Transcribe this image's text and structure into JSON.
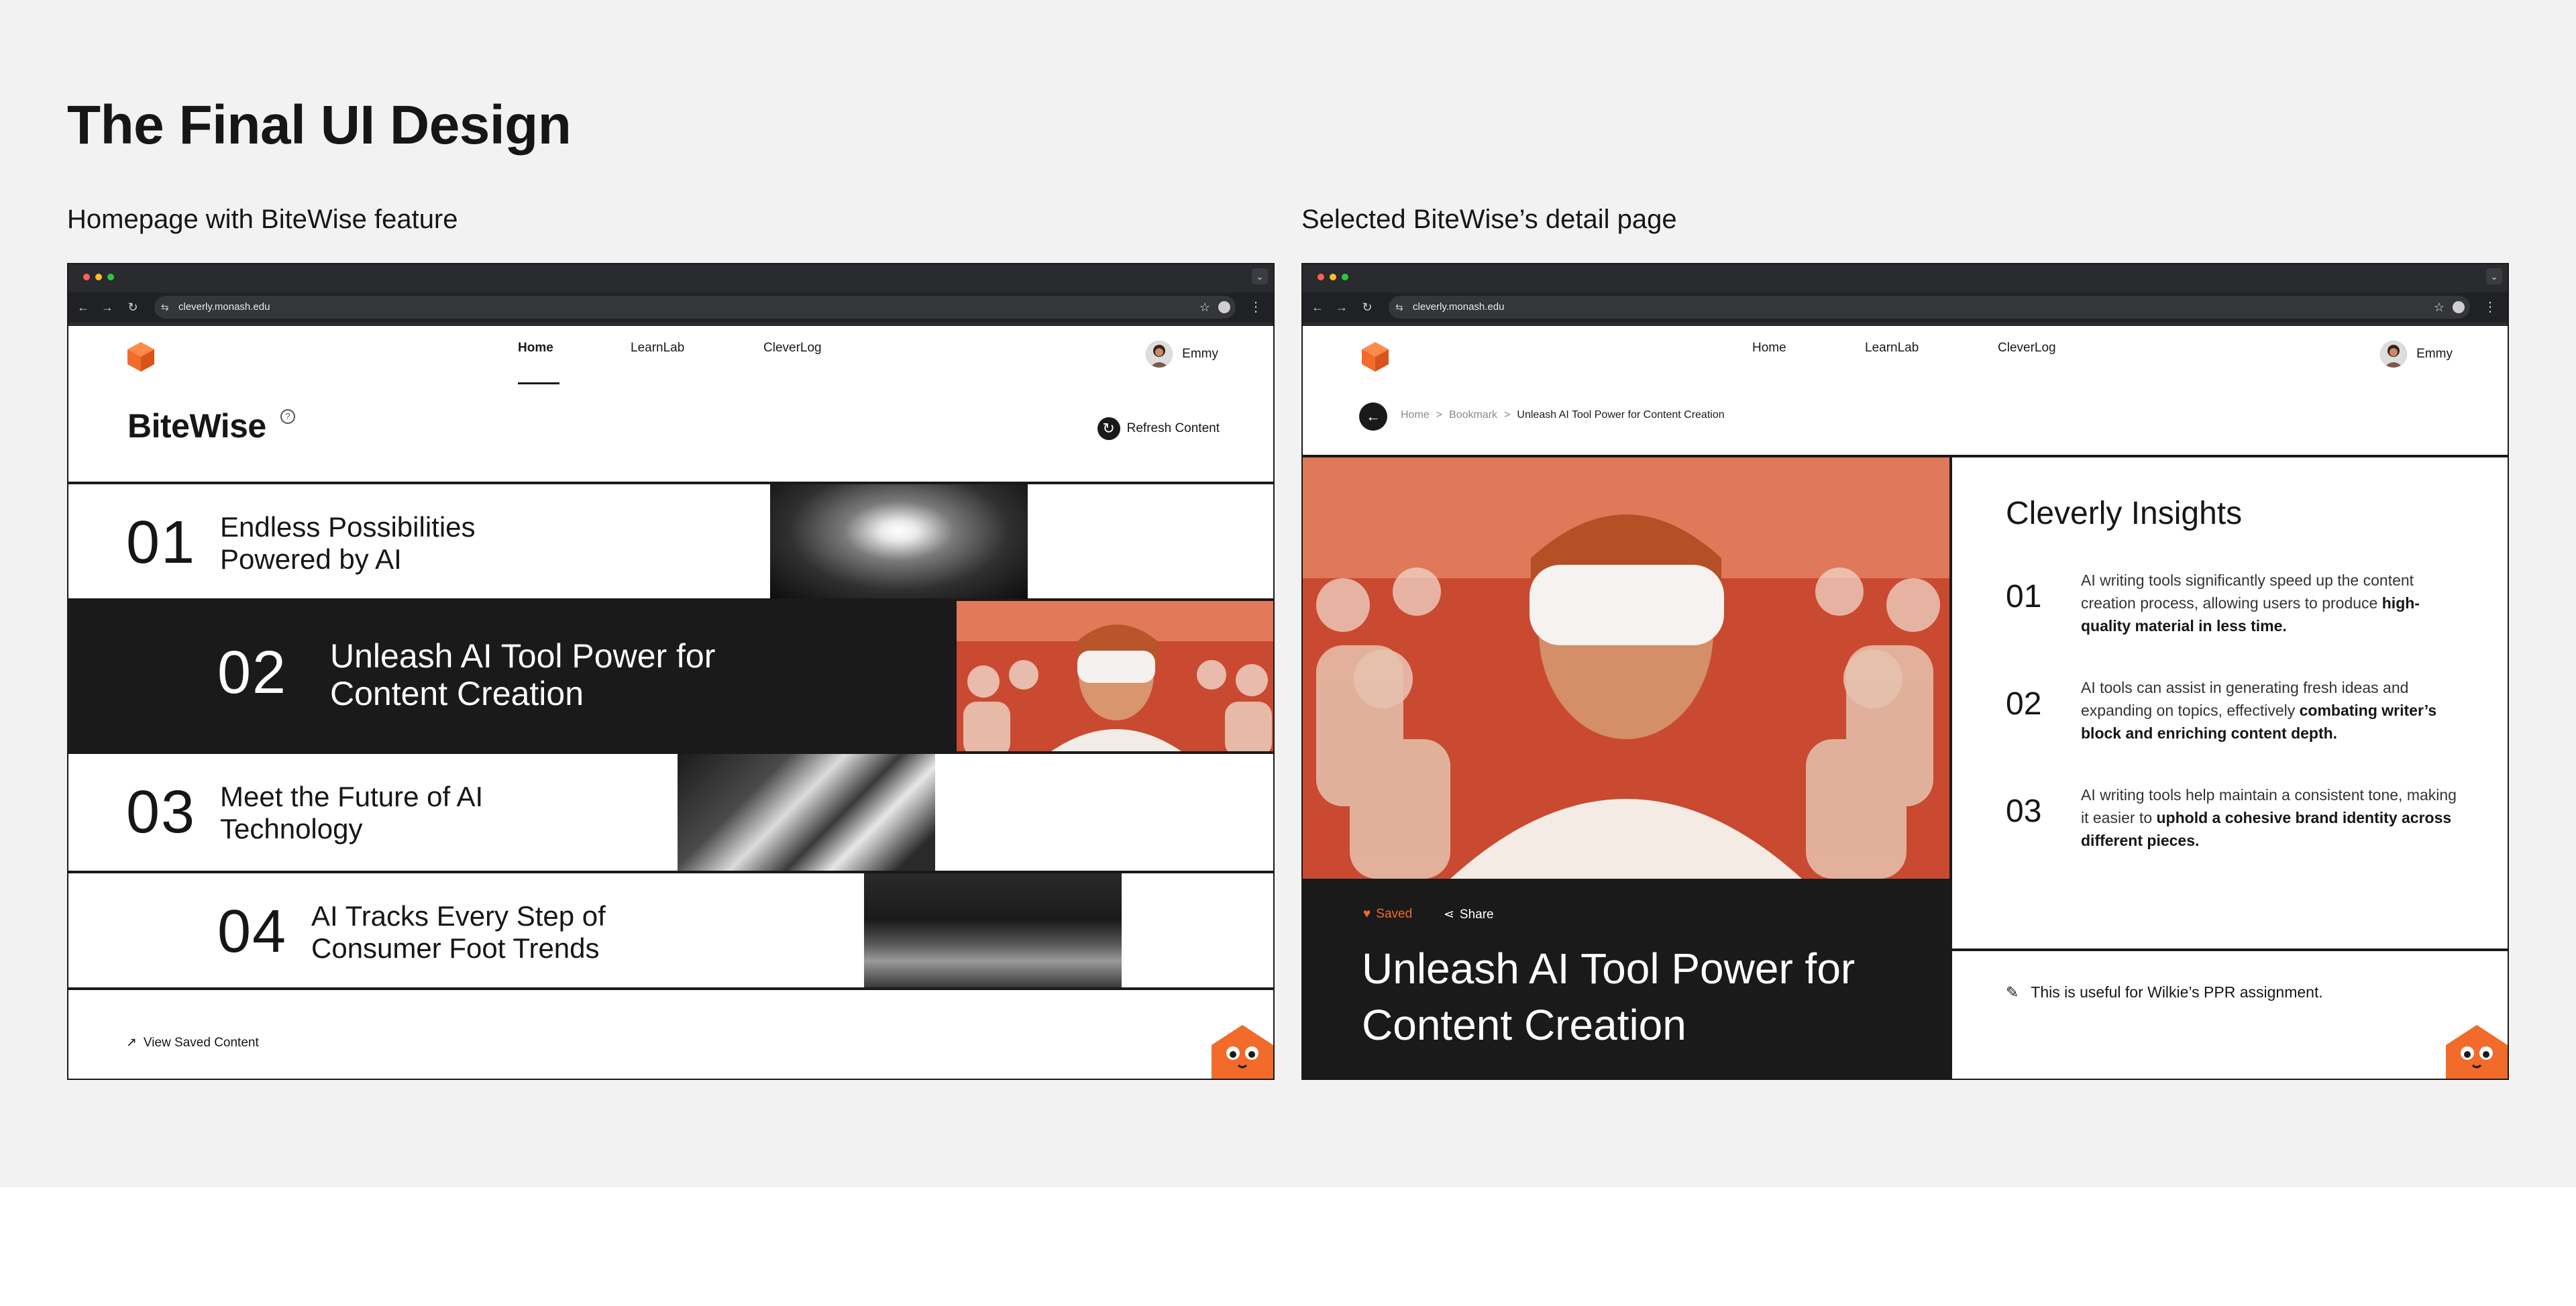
{
  "page": {
    "title": "The Final UI Design",
    "left_caption": "Homepage with BiteWise feature",
    "right_caption": "Selected BiteWise’s detail page"
  },
  "browser": {
    "url": "cleverly.monash.edu",
    "dot_colors": [
      "#ff5f57",
      "#febc2e",
      "#28c840"
    ],
    "icons": {
      "back": "←",
      "forward": "→",
      "reload": "↻",
      "site": "⇆",
      "star": "☆",
      "menu": "⋮",
      "dropdown": "⌄"
    }
  },
  "nav": {
    "items": [
      "Home",
      "LearnLab",
      "CleverLog"
    ],
    "user_name": "Emmy"
  },
  "homepage": {
    "section_title": "BiteWise",
    "help_icon": "?",
    "refresh_label": "Refresh Content",
    "refresh_icon": "↻",
    "items": [
      {
        "num": "01",
        "title": "Endless Possibilities Powered by AI"
      },
      {
        "num": "02",
        "title": "Unleash AI Tool Power for Content Creation"
      },
      {
        "num": "03",
        "title": "Meet the Future of AI Technology"
      },
      {
        "num": "04",
        "title": "AI Tracks Every Step of Consumer Foot Trends"
      }
    ],
    "footer_link": "View Saved Content",
    "footer_icon": "↗"
  },
  "detail": {
    "back_icon": "←",
    "breadcrumb": [
      "Home",
      ">",
      "Bookmark",
      ">",
      "Unleash AI Tool Power for Content Creation"
    ],
    "saved_label": "Saved",
    "saved_icon": "♥",
    "share_label": "Share",
    "share_icon": "⋖",
    "hero_title": "Unleash AI Tool Power for Content Creation",
    "insights_title": "Cleverly Insights",
    "insights": [
      {
        "num": "01",
        "text": "AI writing tools significantly speed up the content creation process, allowing users to produce ",
        "bold": "high-quality material in less time."
      },
      {
        "num": "02",
        "text": "AI tools can assist in generating fresh ideas and expanding on topics, effectively ",
        "bold": "combating writer’s block and enriching content depth."
      },
      {
        "num": "03",
        "text": "AI writing tools help maintain a consistent tone, making it easier to ",
        "bold": "uphold a cohesive brand identity across different pieces."
      }
    ],
    "note": "This is useful for Wilkie’s PPR assignment.",
    "note_icon": "✎"
  },
  "colors": {
    "brand_orange": "#f26b2a",
    "dark": "#1a1a1a",
    "canvas": "#f2f2f2"
  }
}
